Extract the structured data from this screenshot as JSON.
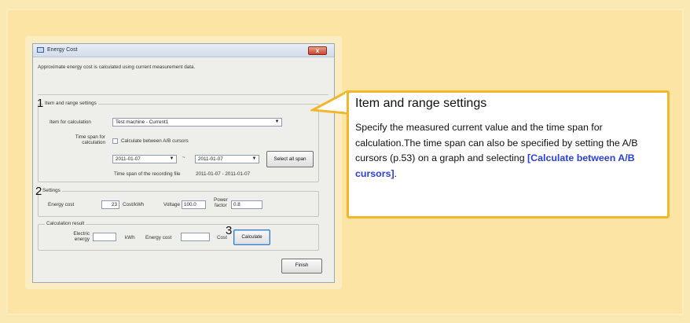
{
  "dialog": {
    "title": "Energy Cost",
    "close_label": "x",
    "description": "Approximate energy cost is calculated using current measurement data.",
    "item_range_group": {
      "legend": "Item and range settings",
      "item_label": "Item for calculation",
      "item_value": "Test machine - Current1",
      "span_label_1": "Time span for",
      "span_label_2": "calculation",
      "checkbox_label": "Calculate between A/B cursors",
      "checkbox_checked": false,
      "start_date": "2011-01-07",
      "range_separator": "~",
      "end_date": "2011-01-07",
      "select_all_label": "Select all span",
      "file_span_label": "Time span of the recording file",
      "file_span_value": "2011-01-07 - 2011-01-07"
    },
    "settings_group": {
      "legend": "Settings",
      "energy_cost_label": "Energy cost",
      "energy_cost_value": "23",
      "energy_cost_unit": "Cost/kWh",
      "voltage_label": "Voltage",
      "voltage_value": "100.0",
      "power_factor_label_1": "Power",
      "power_factor_label_2": "factor",
      "power_factor_value": "0.8"
    },
    "result_group": {
      "legend": "Calculation result",
      "electric_label_1": "Electric",
      "electric_label_2": "energy",
      "electric_value": "",
      "electric_unit": "kWh",
      "energy_cost_label": "Energy cost",
      "energy_cost_value": "",
      "energy_cost_unit": "Cost",
      "calculate_label": "Calculate"
    },
    "finish_label": "Finish"
  },
  "markers": {
    "m1": "1",
    "m2": "2",
    "m3": "3"
  },
  "callout": {
    "title": "Item and range settings",
    "body_text": "Specify the measured current value and the time span for calculation.The time span can also be specified by setting the A/B cursors (p.53) on a graph and selecting ",
    "body_link": "[Calculate between A/B cursors]",
    "body_end": "."
  },
  "colors": {
    "background": "#fbe4a4",
    "callout_border": "#f2b72c",
    "link": "#2b41d6"
  }
}
